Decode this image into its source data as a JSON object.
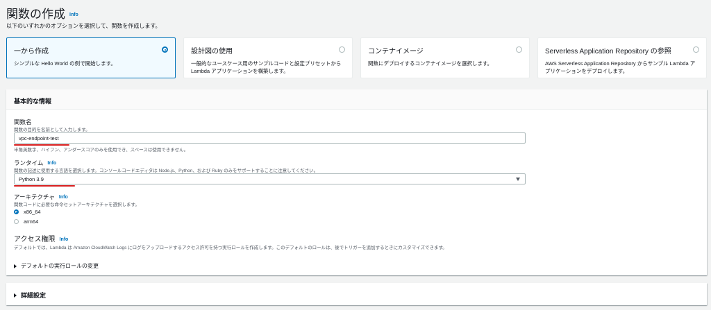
{
  "header": {
    "title": "関数の作成",
    "info": "Info",
    "subtitle": "以下のいずれかのオプションを選択して、関数を作成します。"
  },
  "options": [
    {
      "title": "一から作成",
      "desc": "シンプルな Hello World の例で開始します。",
      "selected": true
    },
    {
      "title": "設計図の使用",
      "desc": "一般的なユースケース用のサンプルコードと設定プリセットから Lambda アプリケーションを構築します。",
      "selected": false
    },
    {
      "title": "コンテナイメージ",
      "desc": "関数にデプロイするコンテナイメージを選択します。",
      "selected": false
    },
    {
      "title": "Serverless Application Repository の参照",
      "desc": "AWS Serverless Application Repository からサンプル Lambda アプリケーションをデプロイします。",
      "selected": false
    }
  ],
  "basic": {
    "header": "基本的な情報",
    "function_name": {
      "label": "関数名",
      "desc": "関数の目的を名前として入力します。",
      "value": "vpc-endpoint-test",
      "hint": "半角英数字、ハイフン、アンダースコアのみを使用でき、スペースは使用できません。"
    },
    "runtime": {
      "label": "ランタイム",
      "info": "Info",
      "desc": "関数の記述に使用する言語を選択します。コンソールコードエディタは Node.js、Python、および Ruby のみをサポートすることに注意してください。",
      "value": "Python 3.9"
    },
    "architecture": {
      "label": "アーキテクチャ",
      "info": "Info",
      "desc": "関数コードに必要な命令セットアーキテクチャを選択します。",
      "options": [
        "x86_64",
        "arm64"
      ],
      "selected": "x86_64"
    },
    "access": {
      "title": "アクセス権限",
      "info": "Info",
      "desc": "デフォルトでは、Lambda は Amazon CloudWatch Logs にログをアップロードするアクセス許可を持つ実行ロールを作成します。このデフォルトのロールは、後でトリガーを追加するときにカスタマイズできます。",
      "expander": "デフォルトの実行ロールの変更"
    }
  },
  "advanced": {
    "label": "詳細設定"
  },
  "colors": {
    "accent": "#0073bb",
    "annotation": "#d81e1e",
    "background": "#f2f3f3"
  }
}
